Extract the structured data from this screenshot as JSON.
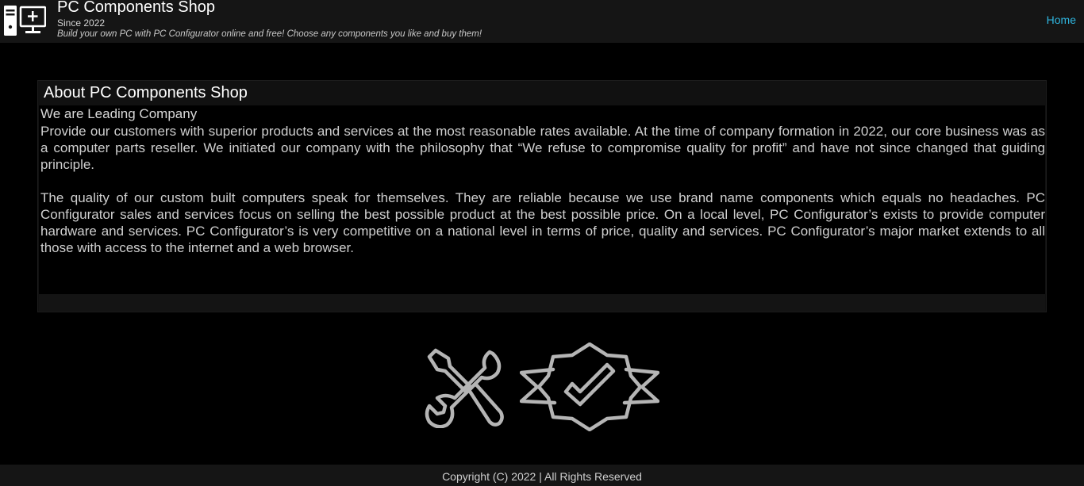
{
  "header": {
    "logo_icon": "pc-monitor-icon",
    "title": "PC Components Shop",
    "since": "Since 2022",
    "tagline": "Build your own PC with PC Configurator online and free! Choose any components you like and buy them!",
    "nav": {
      "home_label": "Home"
    },
    "accent_color": "#2fb6e0"
  },
  "about": {
    "title": "About PC Components Shop",
    "subtitle": "We are Leading Company",
    "paragraphs": [
      "Provide our customers with superior products and services at the most reasonable rates available. At the time of company formation in 2022, our core business was as a computer parts reseller. We initiated our company with the philosophy that “We refuse to compromise quality for profit” and have not since changed that guiding principle.",
      "The quality of our custom built computers speak for themselves. They are reliable because we use brand name components which equals no headaches. PC Configurator sales and services focus on selling the best possible product at the best possible price. On a local level, PC Configurator’s exists to provide computer hardware and services. PC Configurator’s is very competitive on a national level in terms of price, quality and services. PC Configurator’s major market extends to all those with access to the internet and a web browser."
    ]
  },
  "feature_icons": [
    "wrench-screwdriver-icon",
    "quality-badge-check-icon"
  ],
  "footer": {
    "copyright": "Copyright (C) 2022 | All Rights Reserved"
  }
}
